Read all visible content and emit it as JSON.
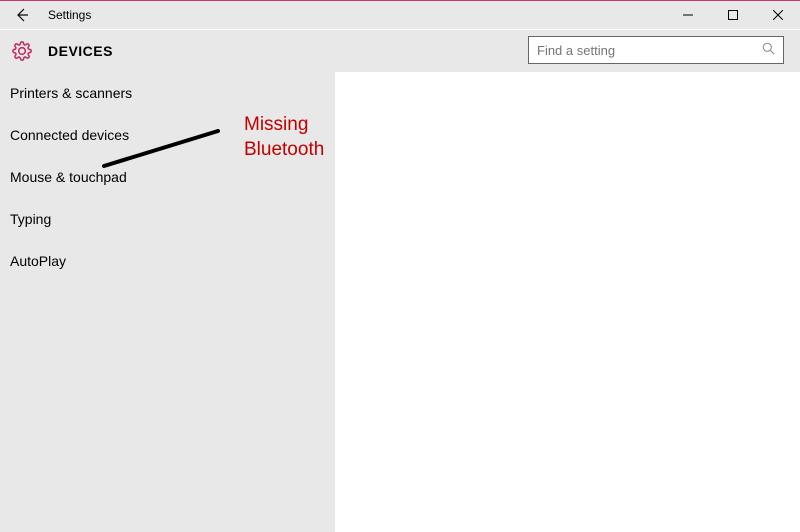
{
  "titlebar": {
    "title": "Settings"
  },
  "header": {
    "page_title": "DEVICES"
  },
  "search": {
    "placeholder": "Find a setting"
  },
  "sidebar": {
    "items": [
      {
        "label": "Printers & scanners"
      },
      {
        "label": "Connected devices"
      },
      {
        "label": "Mouse & touchpad"
      },
      {
        "label": "Typing"
      },
      {
        "label": "AutoPlay"
      }
    ]
  },
  "annotation": {
    "line1": "Missing",
    "line2": "Bluetooth"
  }
}
